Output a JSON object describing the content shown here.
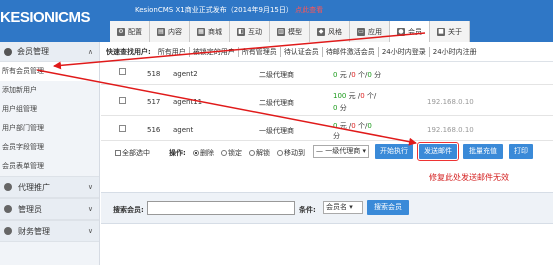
{
  "app": {
    "logo": "KESIONICMS",
    "announcement": "KesionCMS X1商业正式发布（2014年9月15日）",
    "announcement_link": "点此查看"
  },
  "nav_tabs": [
    {
      "label": "配置",
      "icon": "config-icon"
    },
    {
      "label": "内容",
      "icon": "content-icon"
    },
    {
      "label": "商城",
      "icon": "shop-icon"
    },
    {
      "label": "互动",
      "icon": "interact-icon"
    },
    {
      "label": "模型",
      "icon": "model-icon"
    },
    {
      "label": "风格",
      "icon": "style-icon"
    },
    {
      "label": "应用",
      "icon": "app-icon"
    },
    {
      "label": "会员",
      "icon": "user-icon"
    },
    {
      "label": "关于",
      "icon": "about-icon"
    }
  ],
  "sidebar": {
    "header": "会员管理",
    "items": [
      "所有会员管理",
      "添加新用户",
      "用户组管理",
      "用户部门管理",
      "会员字段管理",
      "会员表单管理"
    ],
    "sections": [
      "代理推广",
      "管理员",
      "财务管理"
    ]
  },
  "filterbar": {
    "label": "快速查找用户:",
    "filters": [
      "所有用户",
      "被锁定的用户",
      "所有管理员",
      "待认证会员",
      "待邮件激活会员",
      "24小时内登录",
      "24小时内注册"
    ]
  },
  "rows": [
    {
      "id": "518",
      "username": "agent2",
      "group": "二级代理商",
      "money_g": "0",
      "money_label": "元 /",
      "points_r": "0",
      "points_label": "个/",
      "score_g": "0",
      "score_label": "分",
      "ip": ""
    },
    {
      "id": "517",
      "username": "agent11",
      "group": "二级代理商",
      "money_g": "100",
      "money_label": "元 /",
      "points_r": "0",
      "points_label": "个/",
      "score_g": "0",
      "score_label": "分",
      "ip": "192.168.0.10"
    },
    {
      "id": "516",
      "username": "agent",
      "group": "一级代理商",
      "money_g": "0",
      "money_label": "元 /",
      "points_r": "0",
      "points_label": "个/",
      "score_g": "0",
      "score_label": "分",
      "ip": "192.168.0.10"
    }
  ],
  "operations": {
    "select_all": "全部选中",
    "label": "操作:",
    "radios": [
      "删除",
      "锁定",
      "解锁",
      "移动到"
    ],
    "group_select": "一级代理商",
    "buttons": [
      "开始执行",
      "发送邮件",
      "批量充值",
      "打印"
    ]
  },
  "annotation": "修复此处发送邮件无效",
  "search": {
    "label": "搜索会员:",
    "value": "",
    "cond_label": "条件:",
    "cond_value": "会员名",
    "button": "搜索会员"
  },
  "colors": {
    "topbar": "#2f77c6",
    "button": "#3a8ad8",
    "annotation": "#d42020"
  }
}
